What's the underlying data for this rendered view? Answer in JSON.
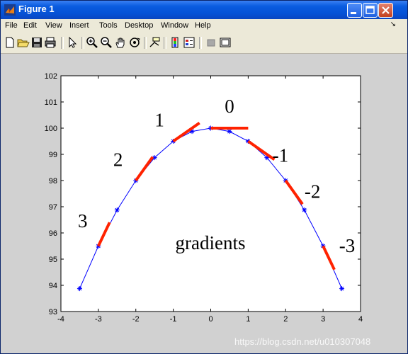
{
  "window": {
    "title": "Figure 1"
  },
  "menubar": {
    "items": [
      "File",
      "Edit",
      "View",
      "Insert",
      "Tools",
      "Desktop",
      "Window",
      "Help"
    ]
  },
  "toolbar": {
    "icons": [
      "new-file-icon",
      "open-folder-icon",
      "save-icon",
      "print-icon",
      "pointer-icon",
      "zoom-in-icon",
      "zoom-out-icon",
      "pan-hand-icon",
      "rotate-3d-icon",
      "data-cursor-icon",
      "colorbar-icon",
      "legend-icon",
      "hide-plot-tools-icon",
      "show-plot-tools-icon"
    ]
  },
  "chart_data": {
    "type": "line",
    "xlim": [
      -4,
      4
    ],
    "ylim": [
      93,
      102
    ],
    "xticks": [
      "-4",
      "-3",
      "-2",
      "-1",
      "0",
      "1",
      "2",
      "3",
      "4"
    ],
    "yticks": [
      "93",
      "94",
      "95",
      "96",
      "97",
      "98",
      "99",
      "100",
      "101",
      "102"
    ],
    "grid": false,
    "x": [
      -3.5,
      -3,
      -2.5,
      -2,
      -1.5,
      -1,
      -0.5,
      0,
      0.5,
      1,
      1.5,
      2,
      2.5,
      3,
      3.5
    ],
    "y": [
      93.875,
      95.5,
      96.875,
      98,
      98.875,
      99.5,
      99.875,
      100,
      99.875,
      99.5,
      98.875,
      98,
      96.875,
      95.5,
      93.875
    ],
    "line_color": "#0000ff",
    "marker": "*",
    "tangent_color": "#ff2200",
    "tangents": [
      {
        "label": "0",
        "x": 0,
        "slope": 0
      },
      {
        "label": "1",
        "x": -1,
        "slope": 1
      },
      {
        "label": "-1",
        "x": 1,
        "slope": -1
      },
      {
        "label": "2",
        "x": -2,
        "slope": 2
      },
      {
        "label": "-2",
        "x": 2,
        "slope": -2
      },
      {
        "label": "3",
        "x": -3,
        "slope": 3
      },
      {
        "label": "-3",
        "x": 3,
        "slope": -3
      }
    ],
    "annotation": "gradients"
  },
  "watermark": "https://blog.csdn.net/u010307048"
}
